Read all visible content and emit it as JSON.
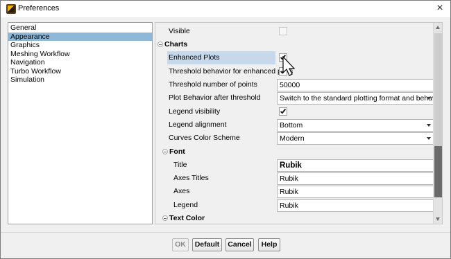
{
  "window": {
    "title": "Preferences",
    "close_glyph": "×",
    "app_icon": "app-logo-icon"
  },
  "categories": {
    "items": [
      {
        "label": "General"
      },
      {
        "label": "Appearance"
      },
      {
        "label": "Graphics"
      },
      {
        "label": "Meshing Workflow"
      },
      {
        "label": "Navigation"
      },
      {
        "label": "Turbo Workflow"
      },
      {
        "label": "Simulation"
      }
    ],
    "selected": "Appearance"
  },
  "properties": {
    "visible": {
      "label": "Visible",
      "checked": false,
      "disabled": true
    },
    "charts": {
      "heading": "Charts",
      "enhanced_plots": {
        "label": "Enhanced Plots",
        "checked": true
      },
      "threshold_behavior": {
        "label": "Threshold behavior for enhanced plots",
        "checked": true
      },
      "threshold_points": {
        "label": "Threshold number of points",
        "value": "50000"
      },
      "plot_behavior": {
        "label": "Plot Behavior after threshold",
        "value": "Switch to the standard plotting format and behavior"
      },
      "legend_visibility": {
        "label": "Legend visibility",
        "checked": true
      },
      "legend_alignment": {
        "label": "Legend alignment",
        "value": "Bottom"
      },
      "curves_color_scheme": {
        "label": "Curves Color Scheme",
        "value": "Modern"
      }
    },
    "font": {
      "heading": "Font",
      "title": {
        "label": "Title",
        "value": "Rubik"
      },
      "axes_titles": {
        "label": "Axes Titles",
        "value": "Rubik"
      },
      "axes": {
        "label": "Axes",
        "value": "Rubik"
      },
      "legend": {
        "label": "Legend",
        "value": "Rubik"
      }
    },
    "text_color": {
      "heading": "Text Color"
    }
  },
  "buttons": {
    "ok": "OK",
    "default": "Default",
    "cancel": "Cancel",
    "help": "Help"
  },
  "colors": {
    "selection": "#8eb7d8",
    "row_highlight": "#c7d8ea",
    "scroll_thumb": "#6b6b6b"
  }
}
